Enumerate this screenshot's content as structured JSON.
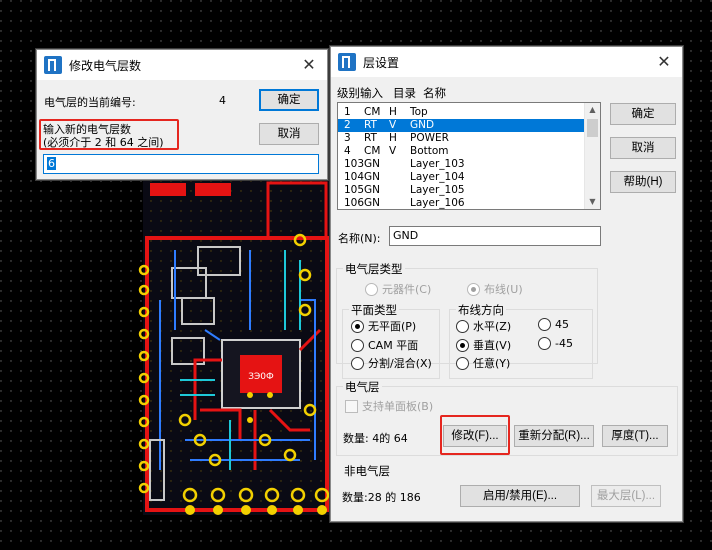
{
  "modify_dialog": {
    "title": "修改电气层数",
    "current_label": "电气层的当前编号:",
    "current_value": "4",
    "ok_label": "确定",
    "cancel_label": "取消",
    "prompt_line1": "输入新的电气层数",
    "prompt_line2": "(必须介于  2 和 64 之间)",
    "input_value": "6",
    "highlight_color": "#e5261f"
  },
  "layer_dialog": {
    "title": "层设置",
    "columns": [
      "级别",
      "输入",
      "目录",
      "名称"
    ],
    "layers": [
      {
        "num": "1",
        "type": "CM",
        "dir": "H",
        "name": "Top",
        "selected": false
      },
      {
        "num": "2",
        "type": "RT",
        "dir": "V",
        "name": "GND",
        "selected": true
      },
      {
        "num": "3",
        "type": "RT",
        "dir": "H",
        "name": "POWER",
        "selected": false
      },
      {
        "num": "4",
        "type": "CM",
        "dir": "V",
        "name": "Bottom",
        "selected": false
      },
      {
        "num": "103",
        "type": "GN",
        "dir": "",
        "name": "Layer_103",
        "selected": false
      },
      {
        "num": "104",
        "type": "GN",
        "dir": "",
        "name": "Layer_104",
        "selected": false
      },
      {
        "num": "105",
        "type": "GN",
        "dir": "",
        "name": "Layer_105",
        "selected": false
      },
      {
        "num": "106",
        "type": "GN",
        "dir": "",
        "name": "Layer_106",
        "selected": false
      }
    ],
    "ok_label": "确定",
    "cancel_label": "取消",
    "help_label": "帮助(H)",
    "name_label": "名称(N):",
    "name_value": "GND",
    "elec_type_title": "电气层类型",
    "component_label": "元器件(C)",
    "routing_label": "布线(U)",
    "plane_type_title": "平面类型",
    "no_plane_label": "无平面(P)",
    "cam_plane_label": "CAM 平面",
    "split_mixed_label": "分割/混合(X)",
    "route_dir_title": "布线方向",
    "horizontal_label": "水平(Z)",
    "vertical_label": "垂直(V)",
    "any_label": "任意(Y)",
    "angle_45_label": "45",
    "angle_m45_label": "-45",
    "elec_layer_title": "电气层",
    "backplane_label": "支持单面板(B)",
    "count_text": "数量: 4的 64",
    "modify_label": "修改(F)...",
    "reassign_label": "重新分配(R)...",
    "thickness_label": "厚度(T)...",
    "non_elec_title": "非电气层",
    "non_elec_count_text": "数量:28 的 186",
    "enable_disable_label": "启用/禁用(E)...",
    "max_layer_label": "最大层(L)...",
    "selection_color": "#0078d7"
  },
  "pcb": {
    "chip_text": "ЗЭ0Ф"
  },
  "icons": [
    "app-icon",
    "close-icon",
    "scroll-up-icon",
    "scroll-down-icon"
  ]
}
